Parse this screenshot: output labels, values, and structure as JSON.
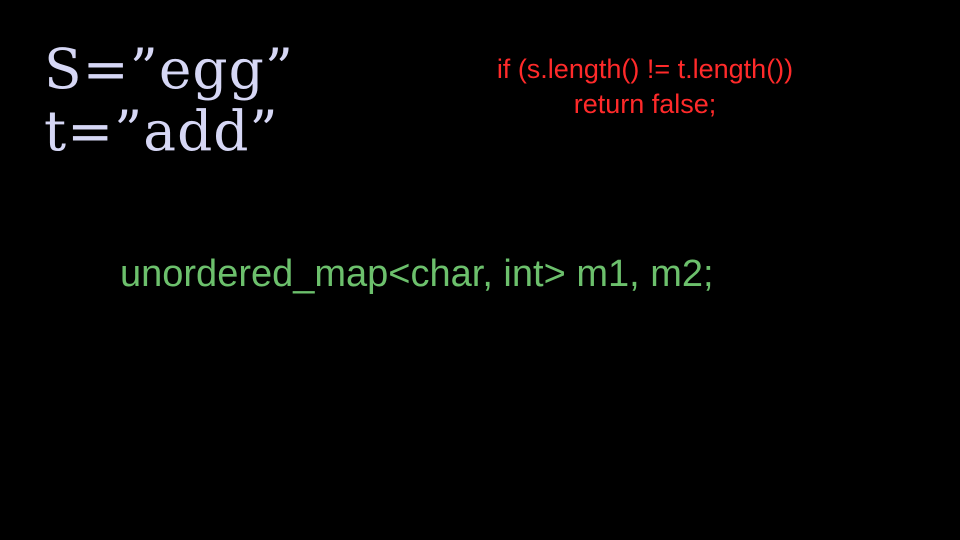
{
  "strings": {
    "s_line": "S=”egg”",
    "t_line": "t=”add”"
  },
  "length_check": {
    "line1": "if (s.length() != t.length())",
    "line2": "return false;"
  },
  "map_decl": "unordered_map<char, int> m1, m2;",
  "colors": {
    "background": "#000000",
    "strings": "#d6d7f5",
    "length_check": "#ff2a2a",
    "map_decl": "#6cc06c"
  }
}
